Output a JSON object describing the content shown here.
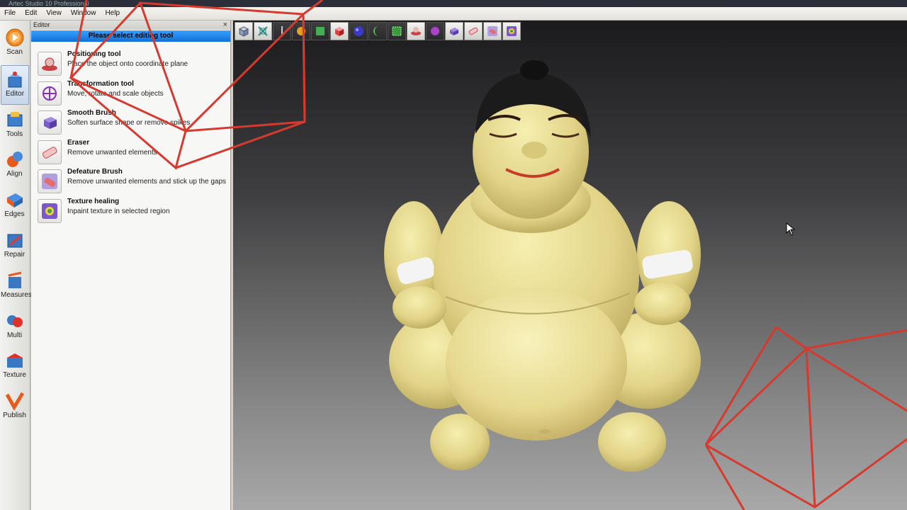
{
  "window": {
    "title": "Artec Studio 10 Professional"
  },
  "menu": [
    "File",
    "Edit",
    "View",
    "Window",
    "Help"
  ],
  "sidebar": [
    {
      "name": "scan",
      "label": "Scan"
    },
    {
      "name": "editor",
      "label": "Editor"
    },
    {
      "name": "tools",
      "label": "Tools"
    },
    {
      "name": "align",
      "label": "Align"
    },
    {
      "name": "edges",
      "label": "Edges"
    },
    {
      "name": "repair",
      "label": "Repair"
    },
    {
      "name": "measures",
      "label": "Measures"
    },
    {
      "name": "multi",
      "label": "Multi"
    },
    {
      "name": "texture",
      "label": "Texture"
    },
    {
      "name": "publish",
      "label": "Publish"
    }
  ],
  "sidebar_active": "Editor",
  "editor": {
    "header": "Editor",
    "close": "×",
    "banner": "Please select editing tool",
    "tools": [
      {
        "title": "Positioning tool",
        "desc": "Place the object onto coordinate plane"
      },
      {
        "title": "Transformation tool",
        "desc": "Move, rotate and scale objects"
      },
      {
        "title": "Smooth Brush",
        "desc": "Soften surface shape or remove spikes"
      },
      {
        "title": "Eraser",
        "desc": "Remove unwanted elements"
      },
      {
        "title": "Defeature Brush",
        "desc": "Remove unwanted elements and stick up the gaps"
      },
      {
        "title": "Texture healing",
        "desc": "Inpaint texture in selected region"
      }
    ]
  },
  "viewport_toolbar": [
    "cube-view-icon",
    "fit-view-icon",
    "axis-icon",
    "light-icon",
    "green-box-icon",
    "red-box-icon",
    "sphere-icon",
    "moon-icon",
    "select-icon",
    "positioning-icon",
    "transform-icon",
    "smooth-brush-icon",
    "eraser-icon",
    "defeature-brush-icon",
    "texture-healing-icon"
  ],
  "colors": {
    "accent": "#1f82f0",
    "overlay_lines": "#d63a2f",
    "model_skin": "#e7dc94"
  }
}
